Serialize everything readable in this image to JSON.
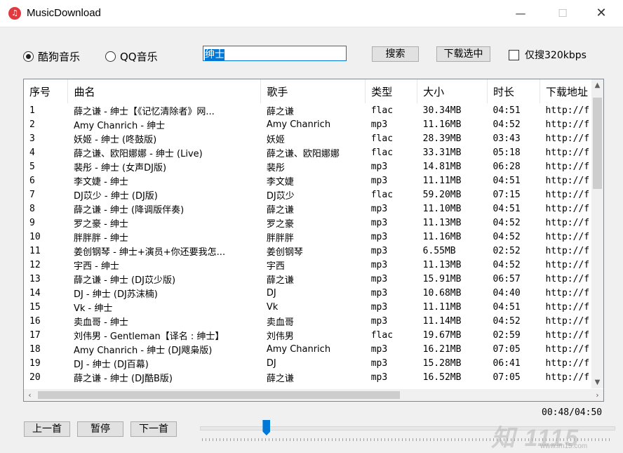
{
  "window": {
    "title": "MusicDownload",
    "icon": "music-note-icon",
    "minimize": "—",
    "maximize": "☐",
    "close": "✕"
  },
  "source": {
    "kugou_label": "酷狗音乐",
    "qq_label": "QQ音乐",
    "selected": "kugou"
  },
  "search": {
    "value": "绅士"
  },
  "toolbar": {
    "search_label": "搜索",
    "download_label": "下载选中",
    "only320_label": "仅搜320kbps",
    "only320_checked": false
  },
  "table": {
    "headers": [
      "序号",
      "曲名",
      "歌手",
      "类型",
      "大小",
      "时长",
      "下载地址"
    ],
    "rows": [
      [
        "1",
        "薛之谦 - 绅士【《记忆清除者》网...",
        "薛之谦",
        "flac",
        "30.34MB",
        "04:51",
        "http://f"
      ],
      [
        "2",
        "Amy Chanrich - 绅士",
        "Amy Chanrich",
        "mp3",
        "11.16MB",
        "04:52",
        "http://f"
      ],
      [
        "3",
        "妖姬 - 绅士 (咚鼓版)",
        "妖姬",
        "flac",
        "28.39MB",
        "03:43",
        "http://f"
      ],
      [
        "4",
        "薛之谦、欧阳娜娜 - 绅士 (Live)",
        "薛之谦、欧阳娜娜",
        "flac",
        "33.31MB",
        "05:18",
        "http://f"
      ],
      [
        "5",
        "裴彤 - 绅士 (女声DJ版)",
        "裴彤",
        "mp3",
        "14.81MB",
        "06:28",
        "http://f"
      ],
      [
        "6",
        "李文婕 - 绅士",
        "李文婕",
        "mp3",
        "11.11MB",
        "04:51",
        "http://f"
      ],
      [
        "7",
        "DJ苡少 - 绅士 (DJ版)",
        "DJ苡少",
        "flac",
        "59.20MB",
        "07:15",
        "http://f"
      ],
      [
        "8",
        "薛之谦 - 绅士 (降调版伴奏)",
        "薛之谦",
        "mp3",
        "11.10MB",
        "04:51",
        "http://f"
      ],
      [
        "9",
        "罗之豪 - 绅士",
        "罗之豪",
        "mp3",
        "11.13MB",
        "04:52",
        "http://f"
      ],
      [
        "10",
        "胖胖胖 - 绅士",
        "胖胖胖",
        "mp3",
        "11.16MB",
        "04:52",
        "http://f"
      ],
      [
        "11",
        "姜创钢琴 - 绅士+演员+你还要我怎...",
        "姜创钢琴",
        "mp3",
        "6.55MB",
        "02:52",
        "http://f"
      ],
      [
        "12",
        "宇西 - 绅士",
        "宇西",
        "mp3",
        "11.13MB",
        "04:52",
        "http://f"
      ],
      [
        "13",
        "薛之谦 - 绅士 (DJ苡少版)",
        "薛之谦",
        "mp3",
        "15.91MB",
        "06:57",
        "http://f"
      ],
      [
        "14",
        "DJ - 绅士 (DJ苏沫楠)",
        "DJ",
        "mp3",
        "10.68MB",
        "04:40",
        "http://f"
      ],
      [
        "15",
        "Vk - 绅士",
        "Vk",
        "mp3",
        "11.11MB",
        "04:51",
        "http://f"
      ],
      [
        "16",
        "卖血哥 - 绅士",
        "卖血哥",
        "mp3",
        "11.14MB",
        "04:52",
        "http://f"
      ],
      [
        "17",
        "刘伟男 - Gentleman【译名 : 绅士】",
        "刘伟男",
        "flac",
        "19.67MB",
        "02:59",
        "http://f"
      ],
      [
        "18",
        "Amy Chanrich - 绅士 (DJ飕枭版)",
        "Amy Chanrich",
        "mp3",
        "16.21MB",
        "07:05",
        "http://f"
      ],
      [
        "19",
        "DJ - 绅士 (DJ百幕)",
        "DJ",
        "mp3",
        "15.28MB",
        "06:41",
        "http://f"
      ],
      [
        "20",
        "薛之谦 - 绅士 (DJ酷B版)",
        "薛之谦",
        "mp3",
        "16.52MB",
        "07:05",
        "http://f"
      ]
    ]
  },
  "player": {
    "prev_label": "上一首",
    "pause_label": "暂停",
    "next_label": "下一首",
    "time": "00:48/04:50",
    "progress": 0.16
  },
  "watermark": {
    "text": "知 1115",
    "url": "www.im15.com"
  }
}
